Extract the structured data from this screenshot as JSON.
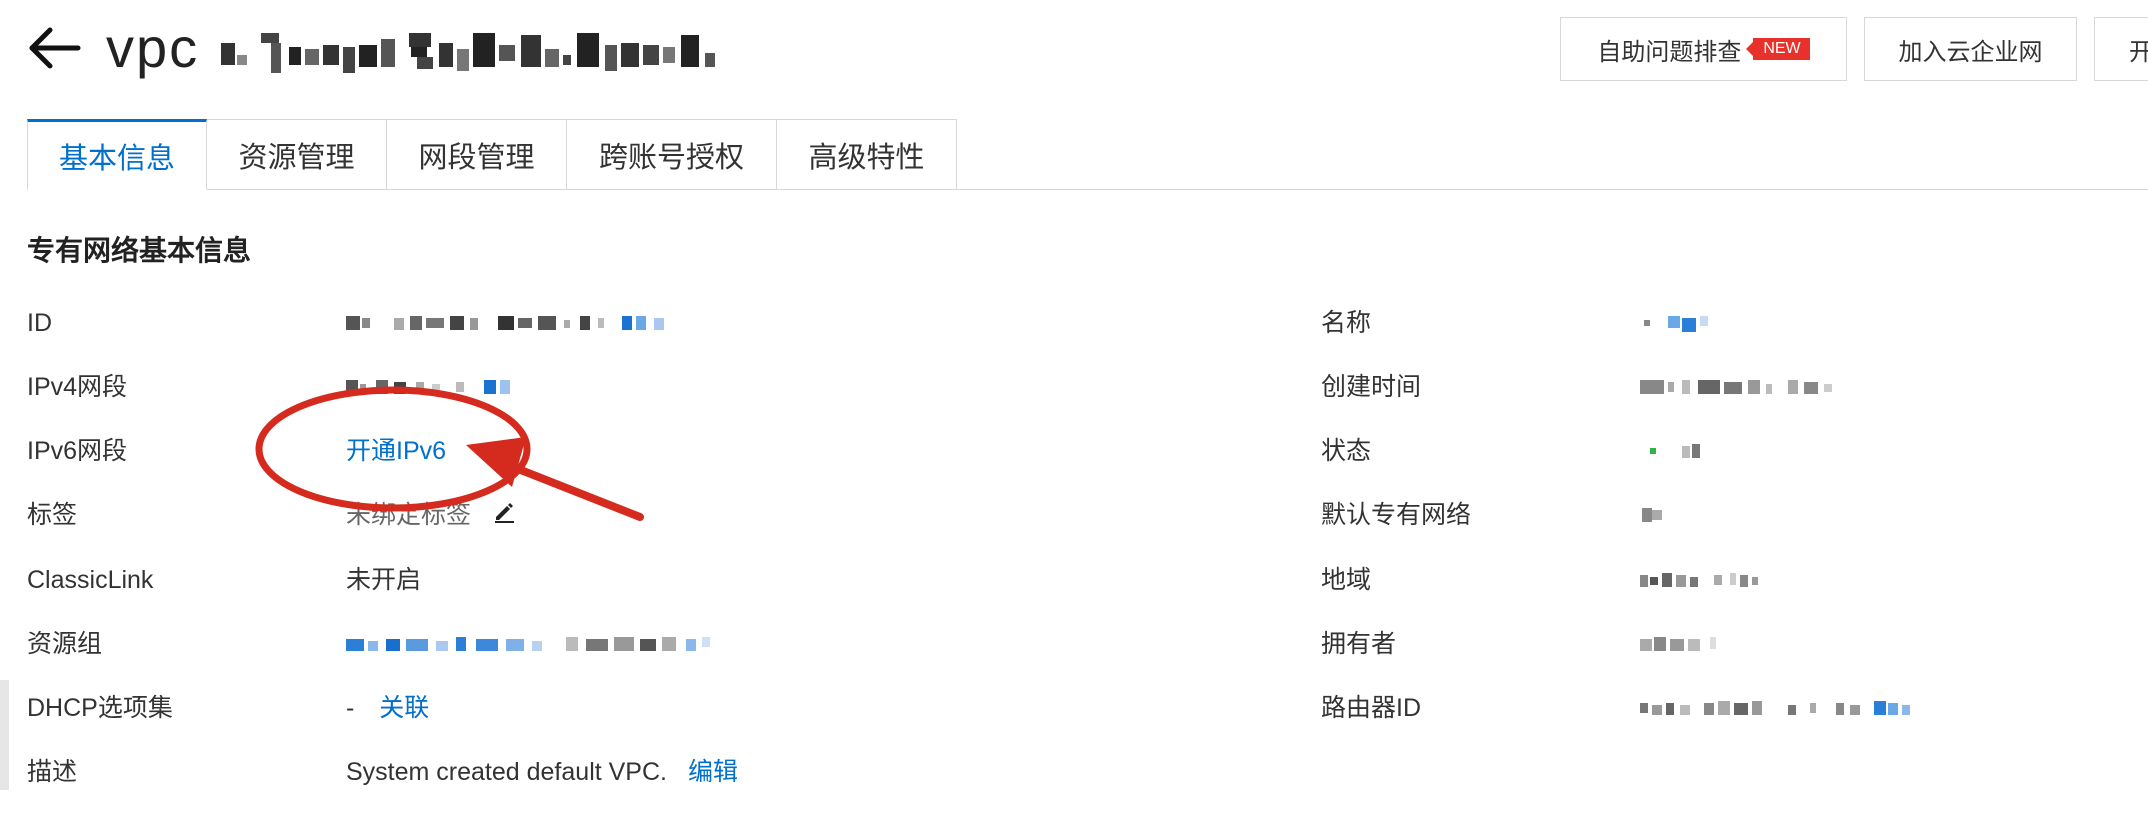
{
  "header": {
    "title_prefix": "vpc",
    "buttons": {
      "self_check": "自助问题排查",
      "new_badge": "NEW",
      "join_cen": "加入云企业网",
      "more": "开"
    }
  },
  "tabs": [
    "基本信息",
    "资源管理",
    "网段管理",
    "跨账号授权",
    "高级特性"
  ],
  "section": {
    "title": "专有网络基本信息"
  },
  "left_fields": {
    "id": {
      "label": "ID"
    },
    "ipv4": {
      "label": "IPv4网段"
    },
    "ipv6": {
      "label": "IPv6网段",
      "link": "开通IPv6"
    },
    "tags": {
      "label": "标签",
      "value": "未绑定标签"
    },
    "classiclink": {
      "label": "ClassicLink",
      "value": "未开启"
    },
    "resource_group": {
      "label": "资源组"
    },
    "dhcp": {
      "label": "DHCP选项集",
      "dash": "-",
      "link": "关联"
    },
    "description": {
      "label": "描述",
      "value": "System created default VPC.",
      "link": "编辑"
    }
  },
  "right_fields": {
    "name": {
      "label": "名称"
    },
    "created": {
      "label": "创建时间"
    },
    "status": {
      "label": "状态"
    },
    "default_vpc": {
      "label": "默认专有网络"
    },
    "region": {
      "label": "地域"
    },
    "owner": {
      "label": "拥有者"
    },
    "router_id": {
      "label": "路由器ID"
    }
  },
  "icons": {
    "back": "arrow-left-icon",
    "edit": "pencil-icon"
  },
  "colors": {
    "primary": "#0070cc",
    "badge": "#e8312b",
    "annotation": "#d42b1e",
    "border": "#d8d8d8"
  }
}
